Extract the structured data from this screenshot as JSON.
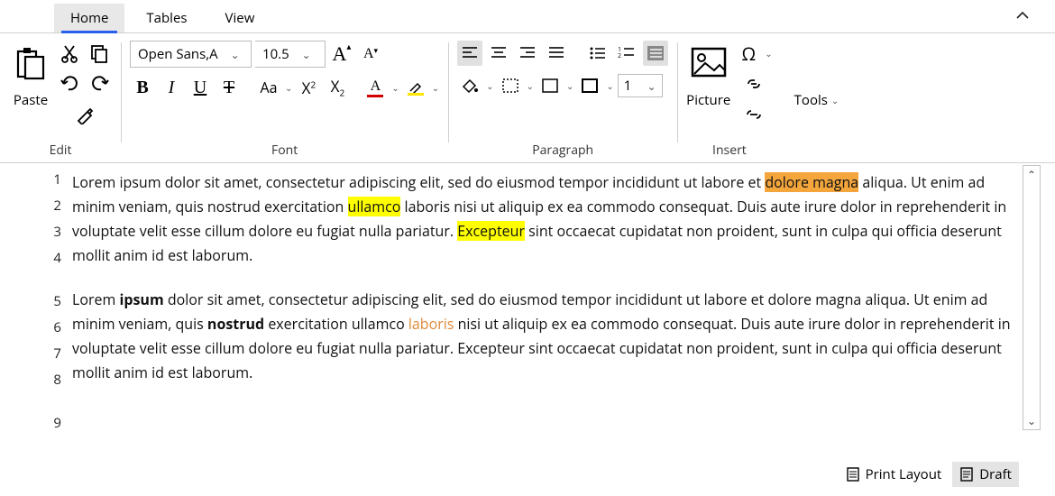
{
  "tabs": {
    "home": "Home",
    "tables": "Tables",
    "view": "View"
  },
  "edit": {
    "label": "Edit",
    "paste": "Paste"
  },
  "font": {
    "label": "Font",
    "name": "Open Sans,A",
    "size": "10.5",
    "change_case": "Aa"
  },
  "paragraph": {
    "label": "Paragraph",
    "indent_val": "1"
  },
  "insert": {
    "label": "Insert",
    "picture": "Picture",
    "omega": "Ω"
  },
  "tools": {
    "label": "Tools"
  },
  "doc": {
    "p1": {
      "t1": "Lorem ipsum dolor sit amet, consectetur adipiscing elit, sed do eiusmod tempor incididunt ut labore et ",
      "hl_o": "dolore magna",
      "t2": " aliqua. Ut enim ad minim veniam, quis nostrud exercitation ",
      "hl_y1": "ullamco",
      "t3": " laboris nisi ut aliquip ex ea commodo consequat. Duis aute irure dolor in reprehenderit in voluptate velit esse cillum dolore eu fugiat nulla pariatur. ",
      "hl_y2": "Excepteur",
      "t4": " sint occaecat cupidatat non proident, sunt in culpa qui officia deserunt mollit anim id est laborum."
    },
    "p2": {
      "t1": "Lorem ",
      "b1": "ipsum",
      "t2": " dolor sit amet, consectetur adipiscing elit, sed do eiusmod tempor incididunt ut labore et dolore magna aliqua. Ut enim ad minim veniam, quis ",
      "b2": "nostrud",
      "t3": " exercitation ullamco ",
      "o1": "laboris",
      "t4": " nisi ut aliquip ex ea commodo consequat. Duis aute irure dolor in reprehenderit in voluptate velit esse cillum dolore eu fugiat nulla pariatur. Excepteur sint occaecat cupidatat non proident, sunt in culpa qui officia deserunt mollit anim id est laborum."
    },
    "lines": {
      "l1": "1",
      "l2": "2",
      "l3": "3",
      "l4": "4",
      "l5": "5",
      "l6": "6",
      "l7": "7",
      "l8": "8",
      "l9": "9"
    }
  },
  "status": {
    "print": "Print Layout",
    "draft": "Draft"
  }
}
